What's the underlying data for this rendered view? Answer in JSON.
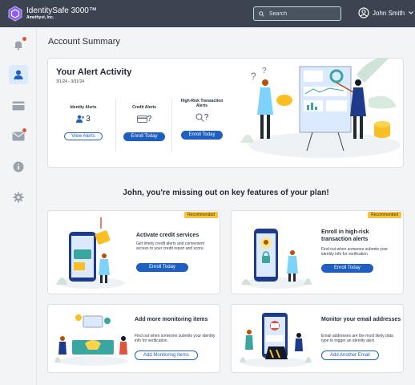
{
  "header": {
    "app_name": "IdentitySafe 3000™",
    "company": "Amethyst, Inc.",
    "search_placeholder": "Search",
    "user_name": "John Smith"
  },
  "sidebar": {
    "items": [
      {
        "name": "notifications",
        "icon": "bell-icon",
        "has_dot": true
      },
      {
        "name": "account",
        "icon": "person-icon",
        "active": true
      },
      {
        "name": "credit",
        "icon": "credit-card-icon"
      },
      {
        "name": "messages",
        "icon": "envelope-icon",
        "has_dot": true
      },
      {
        "name": "info",
        "icon": "info-icon"
      },
      {
        "name": "settings",
        "icon": "gear-icon"
      }
    ]
  },
  "page_title": "Account Summary",
  "alert_activity": {
    "title": "Your Alert Activity",
    "date_range": "3/1/24 - 3/31/24",
    "columns": [
      {
        "label": "Identity Alerts",
        "value": "3",
        "button": "View Alerts"
      },
      {
        "label": "Credit Alerts",
        "value": "?",
        "button": "Enroll Today"
      },
      {
        "label": "High-Risk Transaction Alerts",
        "value": "?",
        "button": "Enroll Today"
      }
    ]
  },
  "missing_heading": "John, you're missing out on key features of your plan!",
  "features": [
    {
      "badge": "Recommended",
      "title": "Activate credit services",
      "description": "Get timely credit alerts and convenient access to your credit report and score.",
      "button": "Enroll Today"
    },
    {
      "badge": "Recommended",
      "title": "Enroll in high-risk transaction alerts",
      "description": "Find out when someone submits your identity info for verification",
      "button": "Enroll Today"
    },
    {
      "title": "Add more monitoring items",
      "description": "Find out when someone submits your identity info for verification.",
      "button": "Add Monitoring Items"
    },
    {
      "title": "Monitor your email addresses",
      "description": "Email addresses are the most likely data type to trigger an identity alert.",
      "button": "Add Another Email"
    }
  ],
  "colors": {
    "topbar": "#3b4450",
    "primary": "#1f5fbf",
    "badge": "#f5c342",
    "notification_dot": "#e0533d",
    "accent_teal": "#3aa6a0"
  }
}
